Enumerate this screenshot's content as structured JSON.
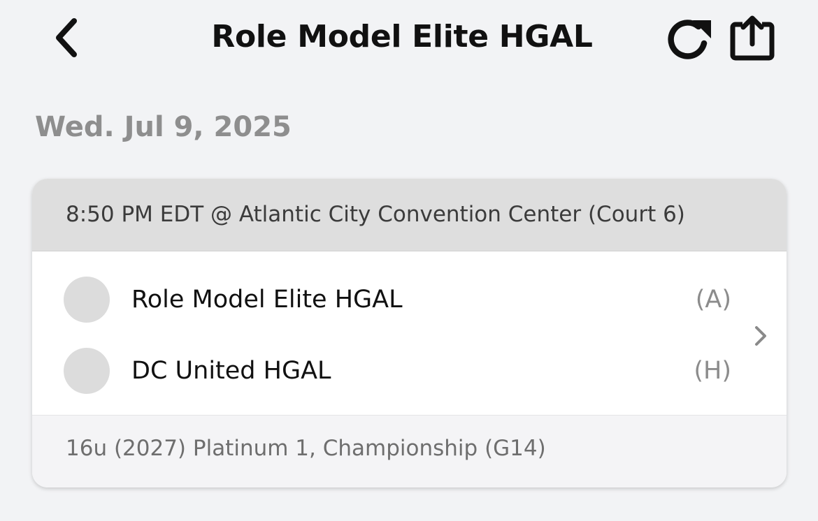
{
  "nav": {
    "title": "Role Model Elite HGAL",
    "back_icon": "chevron-left-icon",
    "refresh_icon": "refresh-icon",
    "share_icon": "share-icon"
  },
  "date": "Wed. Jul 9, 2025",
  "game": {
    "header": "8:50 PM EDT @ Atlantic City Convention Center (Court 6)",
    "teams": [
      {
        "name": "Role Model Elite HGAL",
        "tag": "(A)"
      },
      {
        "name": "DC United HGAL",
        "tag": "(H)"
      }
    ],
    "footer": "16u (2027) Platinum 1, Championship (G14)"
  }
}
